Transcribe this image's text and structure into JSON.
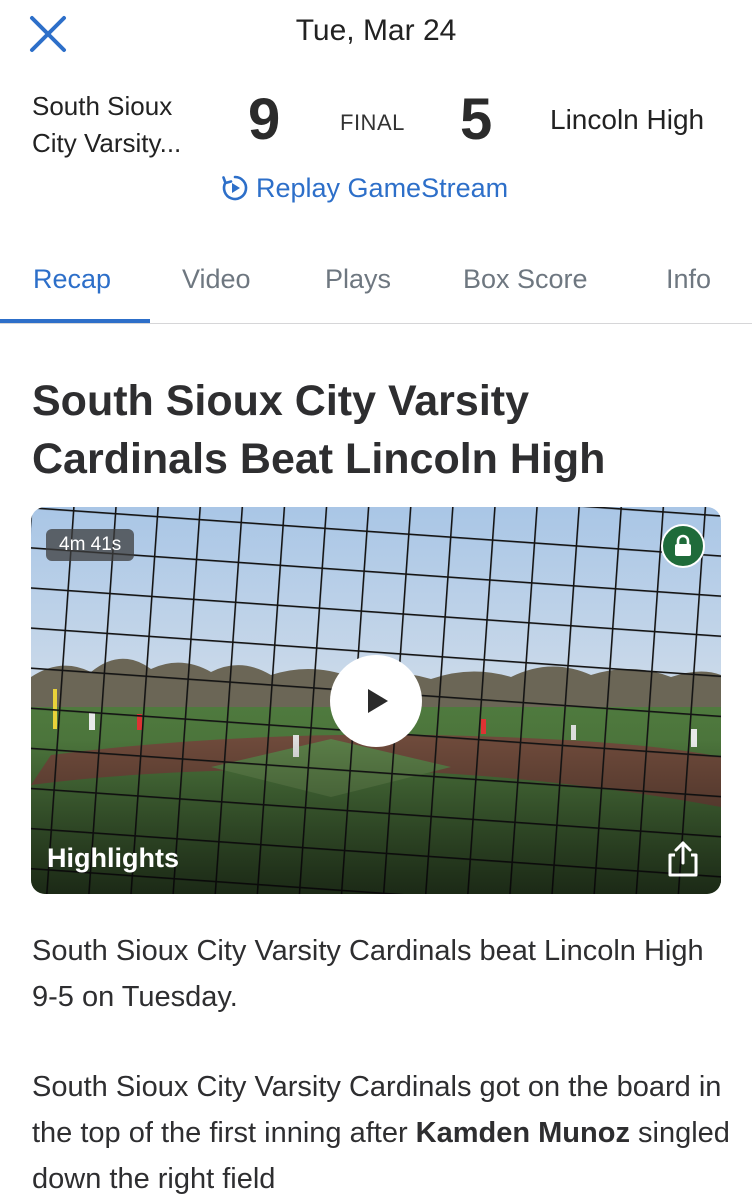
{
  "header": {
    "close_icon": "close-icon",
    "date": "Tue, Mar 24"
  },
  "game": {
    "home_team_line1": "South Sioux",
    "home_team_line2": "City Varsity...",
    "home_score": "9",
    "status": "FINAL",
    "away_score": "5",
    "away_team": "Lincoln High"
  },
  "replay": {
    "icon": "replay-icon",
    "label": "Replay GameStream"
  },
  "tabs": [
    {
      "label": "Recap",
      "active": true
    },
    {
      "label": "Video",
      "active": false
    },
    {
      "label": "Plays",
      "active": false
    },
    {
      "label": "Box Score",
      "active": false
    },
    {
      "label": "Info",
      "active": false
    }
  ],
  "recap": {
    "headline": "South Sioux City Varsity Cardinals Beat Lincoln High",
    "video": {
      "duration": "4m 41s",
      "title": "Highlights",
      "icons": [
        "lock-icon",
        "play-icon",
        "share-icon"
      ]
    },
    "paragraph1": "South Sioux City Varsity Cardinals beat Lincoln High 9-5 on Tuesday.",
    "paragraph2_start": "South Sioux City Varsity Cardinals got on the board in the top of the first inning after ",
    "paragraph2_player": "Kamden Munoz",
    "paragraph2_end": " singled down the right field"
  },
  "colors": {
    "accent": "#2d6fc9",
    "lock_badge": "#1f6b3a"
  }
}
